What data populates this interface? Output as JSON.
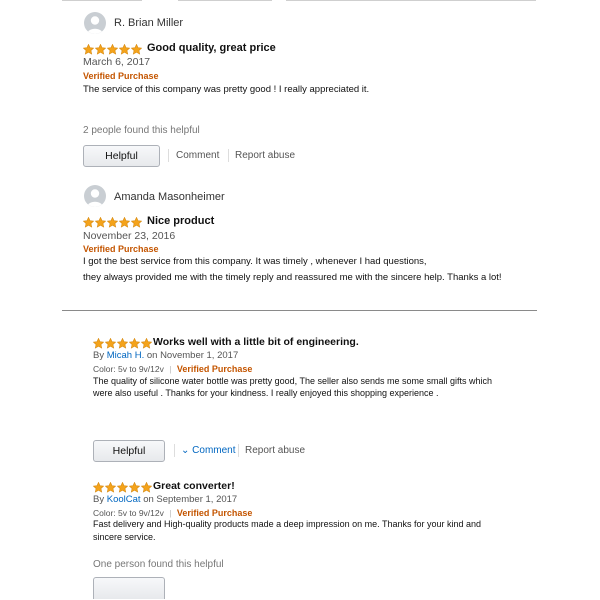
{
  "review1": {
    "reviewer": "R. Brian Miller",
    "rating": 5,
    "title": "Good quality, great price",
    "date": "March 6, 2017",
    "verified": "Verified Purchase",
    "body": "The service of this company was pretty good ! I really appreciated it.",
    "helpful_count": "2 people found this helpful",
    "helpful_button": "Helpful",
    "comment": "Comment",
    "report": "Report abuse"
  },
  "review2": {
    "reviewer": "Amanda Masonheimer",
    "rating": 5,
    "title": "Nice product",
    "date": "November 23, 2016",
    "verified": "Verified Purchase",
    "body_line1": "I got the best service from this company. It was timely , whenever I had questions,",
    "body_line2": "they always provided me with the timely reply and reassured me with the sincere help. Thanks a lot!"
  },
  "review3": {
    "rating": 5,
    "title": "Works well with a little bit of engineering.",
    "by": "By",
    "author": "Micah H.",
    "date": "on November 1, 2017",
    "variant": "Color: 5v to 9v/12v",
    "separator": "|",
    "verified": "Verified Purchase",
    "body_line1": "The quality of silicone water bottle was pretty good, The seller also sends me some small gifts which",
    "body_line2": "were also useful . Thanks for your kindness. I really enjoyed this shopping experience .",
    "helpful_button": "Helpful",
    "comment_chevron": "⌄",
    "comment": "Comment",
    "report": "Report abuse"
  },
  "review4": {
    "rating": 5,
    "title": "Great converter!",
    "by": "By",
    "author": "KoolCat",
    "date": "on September 1, 2017",
    "variant": "Color: 5v to 9v/12v",
    "separator": "|",
    "verified": "Verified Purchase",
    "body_line1": "Fast delivery and High-quality products made a deep impression on me. Thanks for your kind and",
    "body_line2": "sincere service.",
    "helpful_count": "One person found this helpful"
  },
  "colors": {
    "star": "#f4a31b",
    "verified": "#c45500",
    "link": "#0066c0"
  },
  "icons": {
    "avatar": "person-silhouette-icon",
    "star": "star-icon"
  }
}
